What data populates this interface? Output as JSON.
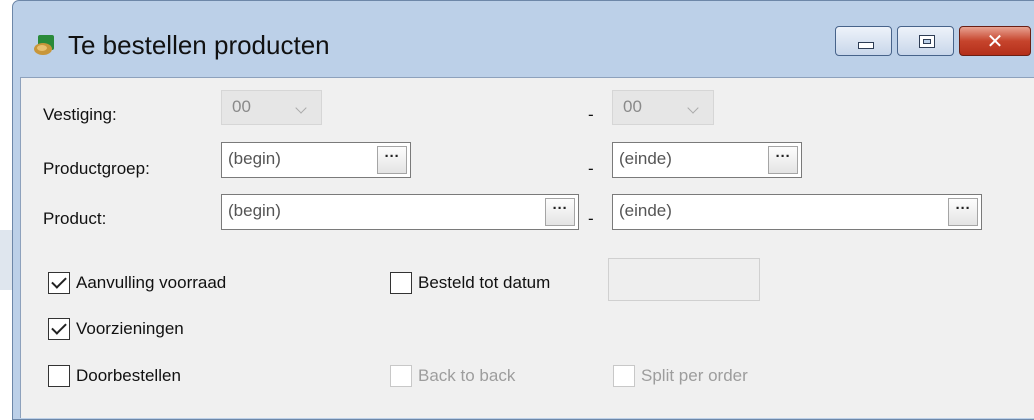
{
  "window": {
    "title": "Te bestellen producten",
    "close_glyph": "✕",
    "icon": "app-window-icon"
  },
  "form": {
    "vestiging": {
      "label": "Vestiging:",
      "from": "00",
      "to": "00"
    },
    "productgroep": {
      "label": "Productgroep:",
      "from": "(begin)",
      "to": "(einde)"
    },
    "product": {
      "label": "Product:",
      "from": "(begin)",
      "to": "(einde)"
    },
    "range_separator": "-",
    "ellipsis": "···"
  },
  "options": {
    "aanvulling_voorraad": {
      "label": "Aanvulling voorraad",
      "checked": true
    },
    "besteld_tot_datum": {
      "label": "Besteld tot datum",
      "checked": false,
      "value": ""
    },
    "voorzieningen": {
      "label": "Voorzieningen",
      "checked": true
    },
    "doorbestellen": {
      "label": "Doorbestellen",
      "checked": false
    },
    "back_to_back": {
      "label": "Back to back",
      "checked": false,
      "enabled": false
    },
    "split_per_order": {
      "label": "Split per order",
      "checked": false,
      "enabled": false
    }
  }
}
